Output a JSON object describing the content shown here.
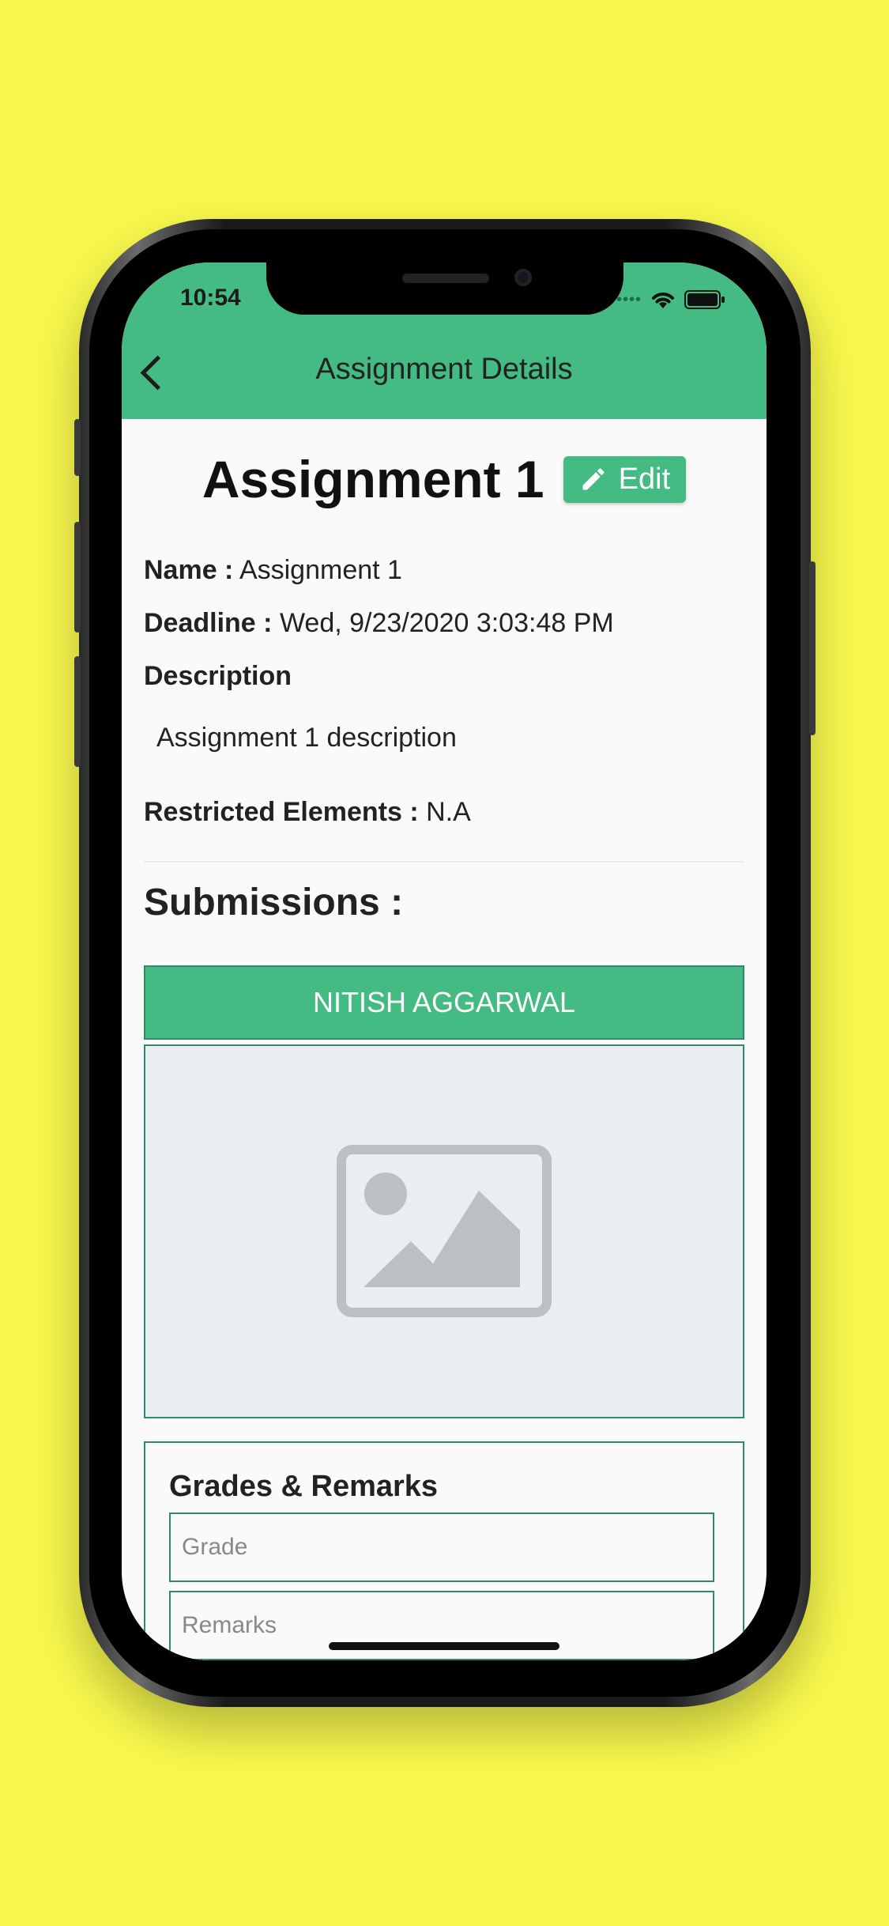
{
  "status_bar": {
    "time": "10:54",
    "signal_dots": "••••"
  },
  "nav": {
    "title": "Assignment Details"
  },
  "assignment": {
    "title": "Assignment 1",
    "edit_label": "Edit",
    "name_label": "Name :",
    "name_value": "Assignment 1",
    "deadline_label": "Deadline :",
    "deadline_value": "Wed, 9/23/2020 3:03:48 PM",
    "description_label": "Description",
    "description_value": "Assignment 1 description",
    "restricted_label": "Restricted Elements :",
    "restricted_value": "N.A"
  },
  "submissions": {
    "title": "Submissions :",
    "student_name": "NITISH AGGARWAL"
  },
  "grades": {
    "title": "Grades & Remarks",
    "grade_placeholder": "Grade",
    "remarks_placeholder": "Remarks"
  },
  "colors": {
    "accent": "#43bb83",
    "background": "#f7f74d",
    "border": "#2e8a68"
  },
  "icons": [
    "chevron-left-icon",
    "pencil-icon",
    "wifi-icon",
    "battery-icon",
    "image-placeholder-icon"
  ]
}
